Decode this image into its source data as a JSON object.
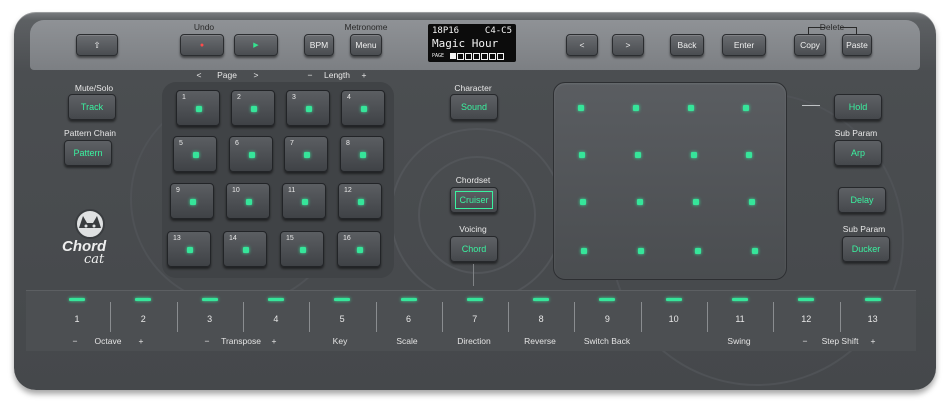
{
  "top_labels": {
    "undo": "Undo",
    "metronome": "Metronome",
    "delete": "Delete"
  },
  "top_buttons": {
    "shift_icon": "⇧",
    "record_icon": "●",
    "play_icon": "▶",
    "bpm": "BPM",
    "menu": "Menu",
    "left": "<",
    "right": ">",
    "back": "Back",
    "enter": "Enter",
    "copy": "Copy",
    "paste": "Paste"
  },
  "screen": {
    "line1_left": "18P16",
    "line1_right": "C4-C5",
    "line2": "Magic Hour",
    "page_label": "PAGE"
  },
  "pad_header": {
    "page_left": "<",
    "page": "Page",
    "page_right": ">",
    "length_minus": "−",
    "length": "Length",
    "length_plus": "+"
  },
  "left_panel": {
    "mute_solo": "Mute/Solo",
    "track": "Track",
    "pattern_chain": "Pattern Chain",
    "pattern": "Pattern"
  },
  "center_panel": {
    "character": "Character",
    "sound": "Sound",
    "chordset": "Chordset",
    "cruiser": "Cruiser",
    "voicing": "Voicing",
    "chord": "Chord"
  },
  "right_panel": {
    "hold": "Hold",
    "sub_param1": "Sub Param",
    "arp": "Arp",
    "delay": "Delay",
    "sub_param2": "Sub Param",
    "ducker": "Ducker"
  },
  "pads": [
    "1",
    "2",
    "3",
    "4",
    "5",
    "6",
    "7",
    "8",
    "9",
    "10",
    "11",
    "12",
    "13",
    "14",
    "15",
    "16"
  ],
  "steps": [
    "1",
    "2",
    "3",
    "4",
    "5",
    "6",
    "7",
    "8",
    "9",
    "10",
    "11",
    "12",
    "13"
  ],
  "bottom_labels": {
    "minus1": "−",
    "octave": "Octave",
    "plus1": "+",
    "minus2": "−",
    "transpose": "Transpose",
    "plus2": "+",
    "key": "Key",
    "scale": "Scale",
    "direction": "Direction",
    "reverse": "Reverse",
    "switch_back": "Switch Back",
    "swing": "Swing",
    "minus3": "−",
    "step_shift": "Step Shift",
    "plus3": "+"
  },
  "logo": {
    "line1": "Chord",
    "line2": "cat"
  },
  "colors": {
    "accent": "#36e59a",
    "record": "#ff4a4a",
    "body": "#4b4e51"
  }
}
